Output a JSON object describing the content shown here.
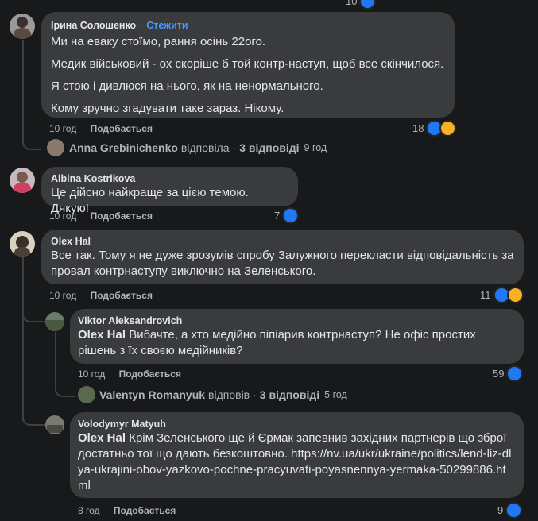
{
  "top_fragment": {
    "count": "10"
  },
  "comments": [
    {
      "author": "Ірина Солошенко",
      "follow": "Стежити",
      "lines": [
        "Ми на еваку стоїмо, рання осінь 22ого.",
        "Медик військовий - ох скоріше б той контр-наступ, щоб все скінчилося.",
        "Я стою і дивлюся на нього, як на ненормального.",
        "Кому зручно згадувати таке зараз. Нікому."
      ],
      "time": "10 год",
      "like_label": "Подобається",
      "reaction_count": "18",
      "replies_summary": {
        "name": "Anna Grebinichenko",
        "action": "відповіла",
        "count": "3 відповіді",
        "time": "9 год"
      }
    },
    {
      "author": "Albina Kostrikova",
      "text": "Це дійсно найкраще за цією темою. Дякую!",
      "time": "10 год",
      "like_label": "Подобається",
      "reaction_count": "7"
    },
    {
      "author": "Olex Hal",
      "text": "Все так. Тому я не дуже зрозумів спробу Залужного перекласти відповідальність за провал контрнаступу виключно на Зеленського.",
      "time": "10 год",
      "like_label": "Подобається",
      "reaction_count": "11",
      "replies": [
        {
          "author": "Viktor Aleksandrovich",
          "mention": "Olex Hal",
          "text": "Вибачте, а хто медійно піпіарив контрнаступ? Не офіс простих рішень з їх своєю медійників?",
          "time": "10 год",
          "like_label": "Подобається",
          "reaction_count": "59",
          "replies_summary": {
            "name": "Valentyn Romanyuk",
            "action": "відповів",
            "count": "3 відповіді",
            "time": "5 год"
          }
        },
        {
          "author": "Volodymyr Matyuh",
          "mention": "Olex Hal",
          "text": "Крім Зеленського ще й Єрмак запевнив західних партнерів що зброї достатньо тої що дають безкоштовно. https://nv.ua/ukr/ukraine/politics/lend-liz-dlya-ukrajini-obov-yazkovo-pochne-pracyuvati-poyasnennya-yermaka-50299886.html",
          "time": "8 год",
          "like_label": "Подобається",
          "reaction_count": "9"
        }
      ]
    }
  ],
  "colors": {
    "background": "#18191a",
    "bubble": "#3a3b3c",
    "accent": "#4599ff",
    "like": "#2078f4"
  },
  "icons": [
    "like-reaction-icon",
    "care-reaction-icon",
    "haha-reaction-icon"
  ]
}
